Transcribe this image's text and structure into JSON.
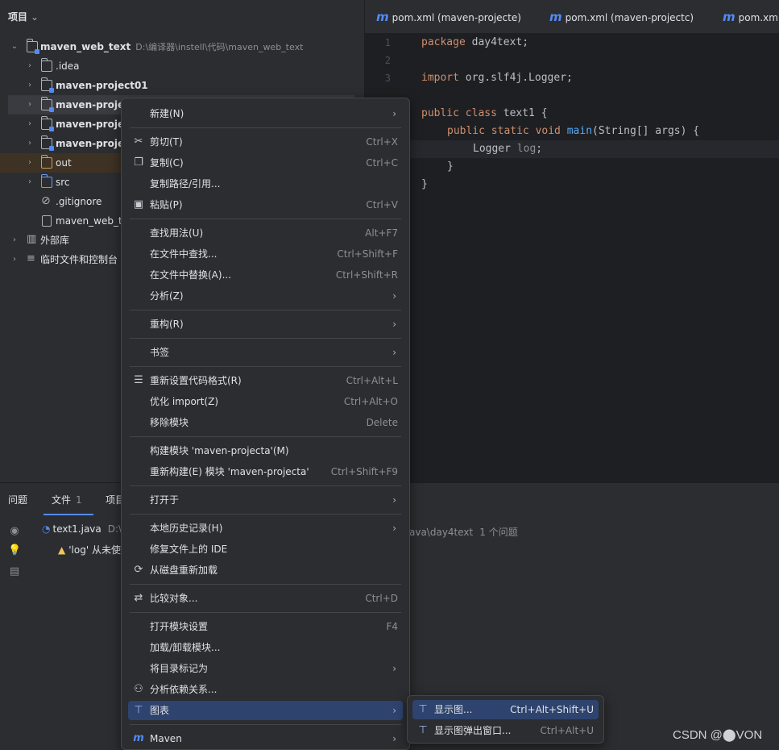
{
  "project": {
    "header": "项目",
    "tree": [
      {
        "label": "maven_web_text",
        "path": "D:\\编译器\\instell\\代码\\maven_web_text"
      },
      {
        "label": ".idea"
      },
      {
        "label": "maven-project01"
      },
      {
        "label": "maven-projec"
      },
      {
        "label": "maven-projec"
      },
      {
        "label": "maven-projec"
      },
      {
        "label": "out"
      },
      {
        "label": "src"
      },
      {
        "label": ".gitignore"
      },
      {
        "label": "maven_web_te"
      },
      {
        "label": "外部库"
      },
      {
        "label": "临时文件和控制台"
      }
    ]
  },
  "tabs": [
    {
      "label": "pom.xml (maven-projecte)",
      "icon": "m"
    },
    {
      "label": "pom.xml (maven-projectc)",
      "icon": "m"
    },
    {
      "label": "pom.xml",
      "icon": "m"
    }
  ],
  "editor": {
    "line_numbers": [
      "1",
      "2",
      "3"
    ],
    "code": {
      "l1_kw": "package",
      "l1_rest": " day4text;",
      "l3_kw": "import",
      "l3_rest": " org.slf4j.Logger;",
      "l5_kw": "public class",
      "l5_rest": " text1 {",
      "l6_kw": "public static void",
      "l6_fn": "main",
      "l6_rest": "(String[] args) {",
      "l7_type": "Logger",
      "l7_var": "log",
      "l7_end": ";",
      "l8": "}",
      "l9": "}"
    }
  },
  "bottom": {
    "tabs": [
      {
        "label": "问题"
      },
      {
        "label": "文件",
        "count": "1"
      },
      {
        "label": "项目"
      }
    ],
    "file": {
      "name": "text1.java",
      "path": "D:\\"
    },
    "path_tail": "ava\\day4text",
    "problem_count": "1 个问题",
    "warning": "'log' 从未使"
  },
  "menu": {
    "items": [
      {
        "label": "新建(N)",
        "arrow": true
      },
      {
        "label": "剪切(T)",
        "shortcut": "Ctrl+X",
        "icon": "scissors-icon"
      },
      {
        "label": "复制(C)",
        "shortcut": "Ctrl+C",
        "icon": "copy-icon"
      },
      {
        "label": "复制路径/引用..."
      },
      {
        "label": "粘贴(P)",
        "shortcut": "Ctrl+V",
        "icon": "paste-icon"
      },
      {
        "label": "查找用法(U)",
        "shortcut": "Alt+F7"
      },
      {
        "label": "在文件中查找...",
        "shortcut": "Ctrl+Shift+F"
      },
      {
        "label": "在文件中替换(A)...",
        "shortcut": "Ctrl+Shift+R"
      },
      {
        "label": "分析(Z)",
        "arrow": true
      },
      {
        "label": "重构(R)",
        "arrow": true
      },
      {
        "label": "书签",
        "arrow": true
      },
      {
        "label": "重新设置代码格式(R)",
        "shortcut": "Ctrl+Alt+L",
        "icon": "reformat-icon"
      },
      {
        "label": "优化 import(Z)",
        "shortcut": "Ctrl+Alt+O"
      },
      {
        "label": "移除模块",
        "shortcut": "Delete"
      },
      {
        "label": "构建模块 'maven-projecta'(M)"
      },
      {
        "label": "重新构建(E) 模块 'maven-projecta'",
        "shortcut": "Ctrl+Shift+F9"
      },
      {
        "label": "打开于",
        "arrow": true
      },
      {
        "label": "本地历史记录(H)",
        "arrow": true
      },
      {
        "label": "修复文件上的 IDE"
      },
      {
        "label": "从磁盘重新加载",
        "icon": "reload-icon"
      },
      {
        "label": "比较对象...",
        "shortcut": "Ctrl+D",
        "icon": "compare-icon"
      },
      {
        "label": "打开模块设置",
        "shortcut": "F4"
      },
      {
        "label": "加载/卸载模块..."
      },
      {
        "label": "将目录标记为",
        "arrow": true
      },
      {
        "label": "分析依赖关系...",
        "icon": "dependency-icon"
      },
      {
        "label": "图表",
        "arrow": true,
        "icon": "diagram-icon",
        "highlighted": true
      },
      {
        "label": "Maven",
        "arrow": true,
        "icon": "maven-icon"
      }
    ]
  },
  "submenu": {
    "items": [
      {
        "label": "显示图...",
        "shortcut": "Ctrl+Alt+Shift+U",
        "highlighted": true
      },
      {
        "label": "显示图弹出窗口...",
        "shortcut": "Ctrl+Alt+U"
      }
    ]
  },
  "watermark": "CSDN @⬤VON",
  "colors": {
    "accent": "#548af7",
    "highlight": "#2e436e",
    "keyword": "#cf8e6d",
    "function": "#56a8f5"
  }
}
